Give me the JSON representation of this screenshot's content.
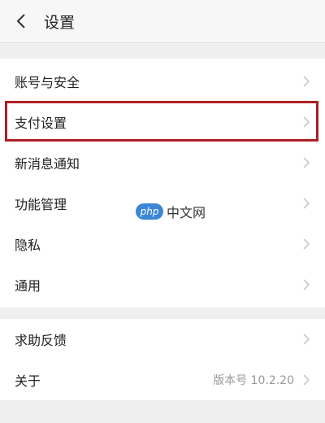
{
  "header": {
    "title": "设置"
  },
  "group1": {
    "items": [
      {
        "label": "账号与安全"
      },
      {
        "label": "支付设置"
      },
      {
        "label": "新消息通知"
      },
      {
        "label": "功能管理"
      },
      {
        "label": "隐私"
      },
      {
        "label": "通用"
      }
    ]
  },
  "group2": {
    "items": [
      {
        "label": "求助反馈"
      },
      {
        "label": "关于",
        "value": "版本号 10.2.20"
      }
    ]
  },
  "watermark": {
    "logo": "php",
    "text": "中文网"
  },
  "colors": {
    "highlight": "#b01e23",
    "chevron": "#c8c8c8",
    "background": "#efefef"
  },
  "icons": {
    "back": "chevron-left-icon",
    "row": "chevron-right-icon"
  }
}
